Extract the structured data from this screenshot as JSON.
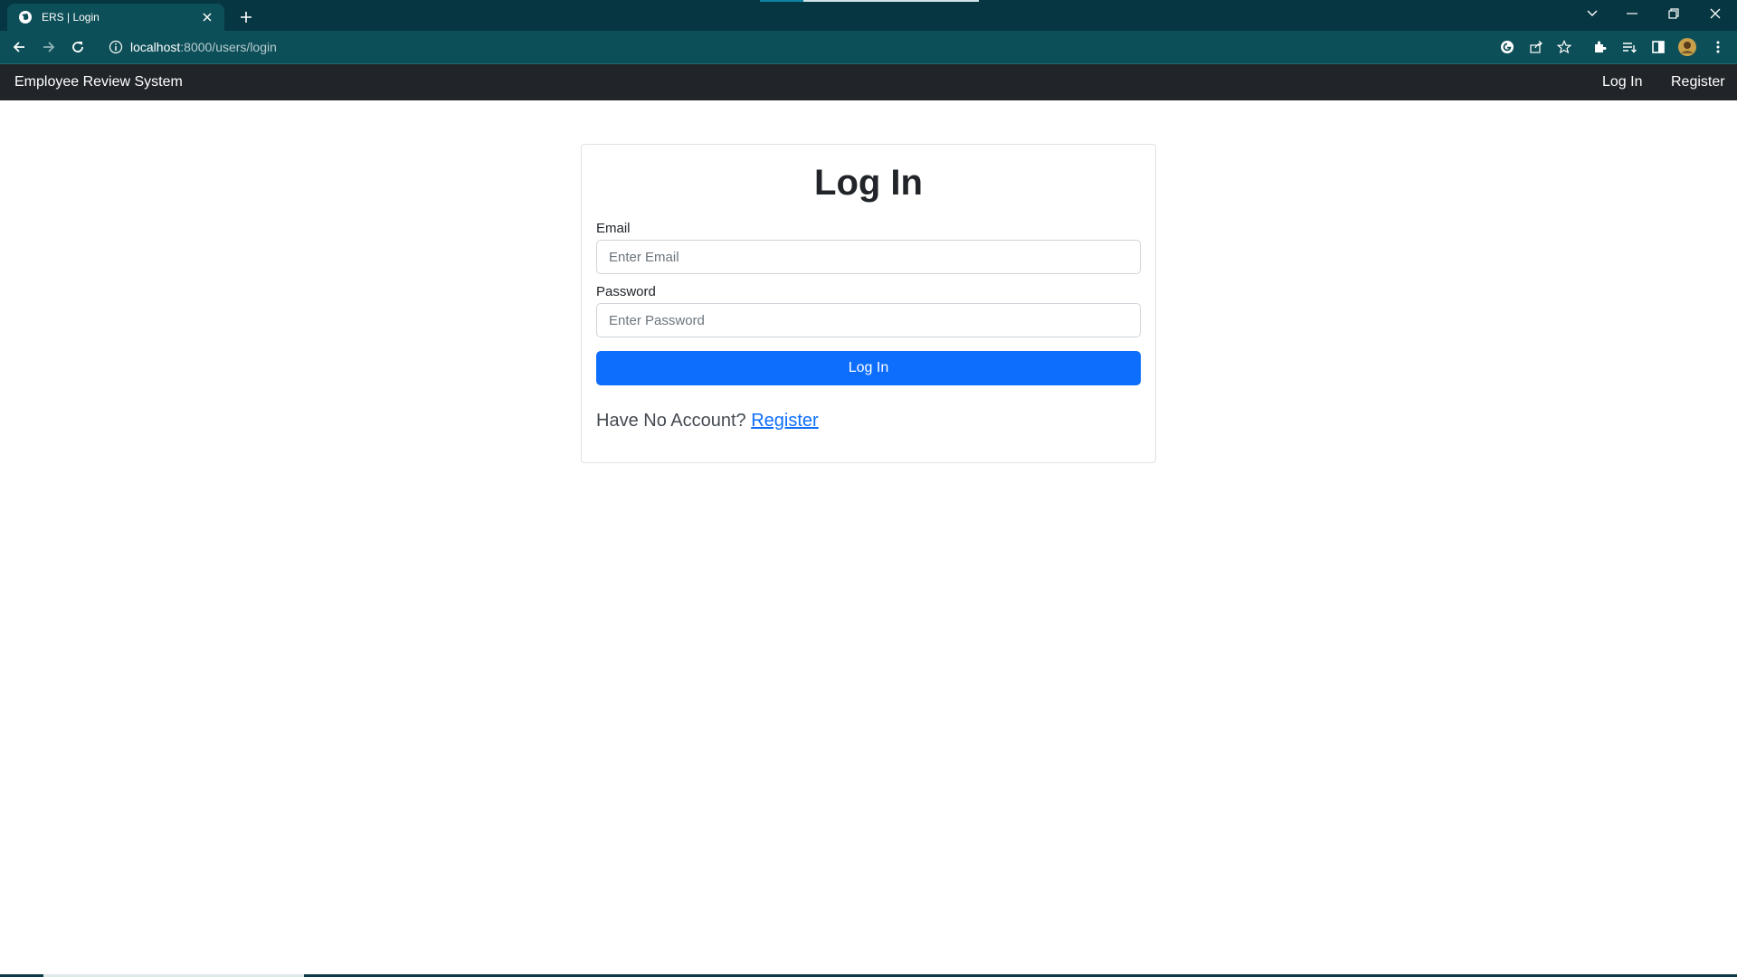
{
  "browser": {
    "tab_title": "ERS | Login",
    "url_host": "localhost",
    "url_path": ":8000/users/login",
    "colors": {
      "tabbar": "#063641",
      "toolbar": "#0d4f58"
    }
  },
  "navbar": {
    "brand": "Employee Review System",
    "links": [
      {
        "label": "Log In"
      },
      {
        "label": "Register"
      }
    ],
    "color": "#212529"
  },
  "login": {
    "title": "Log In",
    "email_label": "Email",
    "email_placeholder": "Enter Email",
    "email_value": "",
    "password_label": "Password",
    "password_placeholder": "Enter Password",
    "password_value": "",
    "submit_label": "Log In",
    "no_account_text": "Have No Account?",
    "register_link": "Register",
    "button_color": "#0d6efd"
  }
}
